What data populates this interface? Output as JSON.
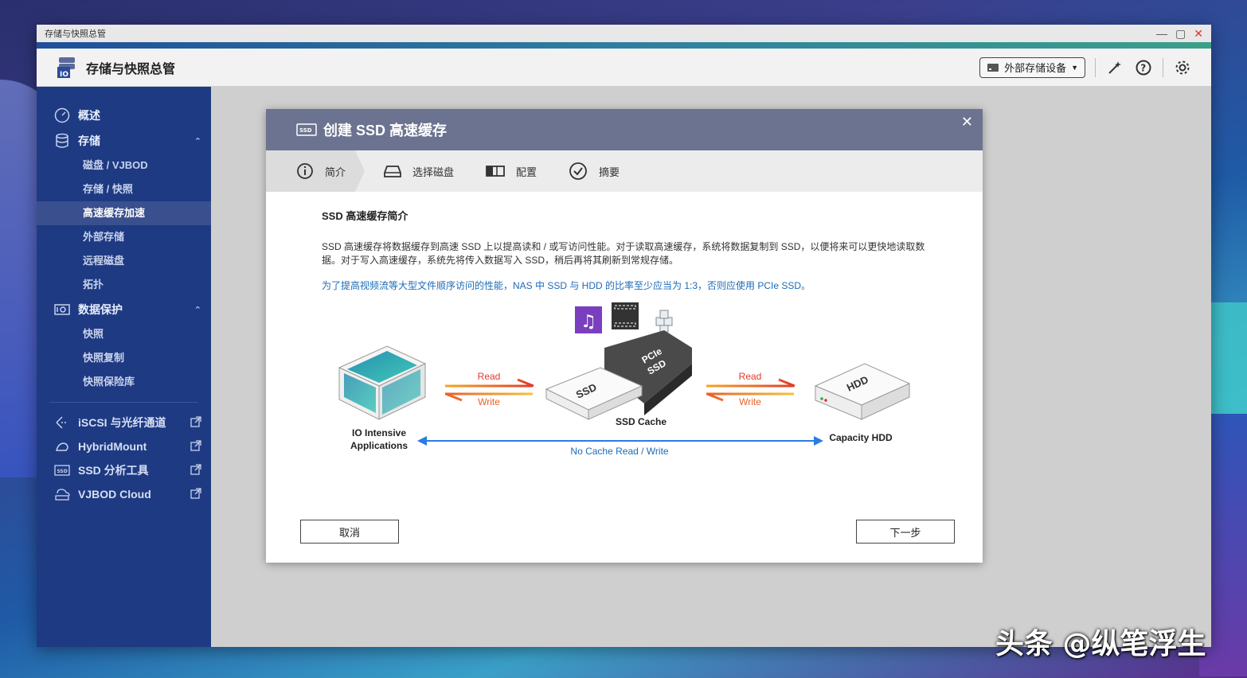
{
  "window": {
    "title": "存储与快照总管"
  },
  "header": {
    "app_title": "存储与快照总管",
    "external_storage_label": "外部存储设备"
  },
  "sidebar": {
    "overview": "概述",
    "storage": "存储",
    "storage_items": [
      "磁盘 / VJBOD",
      "存储 / 快照",
      "高速缓存加速",
      "外部存储",
      "远程磁盘",
      "拓扑"
    ],
    "data_protection": "数据保护",
    "protection_items": [
      "快照",
      "快照复制",
      "快照保险库"
    ],
    "links": [
      "iSCSI 与光纤通道",
      "HybridMount",
      "SSD 分析工具",
      "VJBOD Cloud"
    ]
  },
  "dialog": {
    "title": "创建 SSD 高速缓存",
    "steps": [
      "简介",
      "选择磁盘",
      "配置",
      "摘要"
    ],
    "subtitle": "SSD 高速缓存简介",
    "paragraph": "SSD 高速缓存将数据缓存到高速 SSD 上以提高读和 / 或写访问性能。对于读取高速缓存，系统将数据复制到 SSD，以便将来可以更快地读取数据。对于写入高速缓存，系统先将传入数据写入 SSD，稍后再将其刷新到常规存储。",
    "note": "为了提高视频流等大型文件顺序访问的性能，NAS 中 SSD 与 HDD 的比率至少应当为 1:3，否则应使用 PCIe SSD。",
    "cancel": "取消",
    "next": "下一步"
  },
  "diagram": {
    "app_label_1": "IO Intensive",
    "app_label_2": "Applications",
    "read": "Read",
    "write": "Write",
    "ssd_cache": "SSD Cache",
    "capacity_hdd": "Capacity HDD",
    "no_cache": "No Cache Read / Write",
    "ssd_text": "SSD",
    "pcie_text_1": "PCIe",
    "pcie_text_2": "SSD",
    "hdd_text": "HDD"
  },
  "watermark": "头条 @纵笔浮生"
}
